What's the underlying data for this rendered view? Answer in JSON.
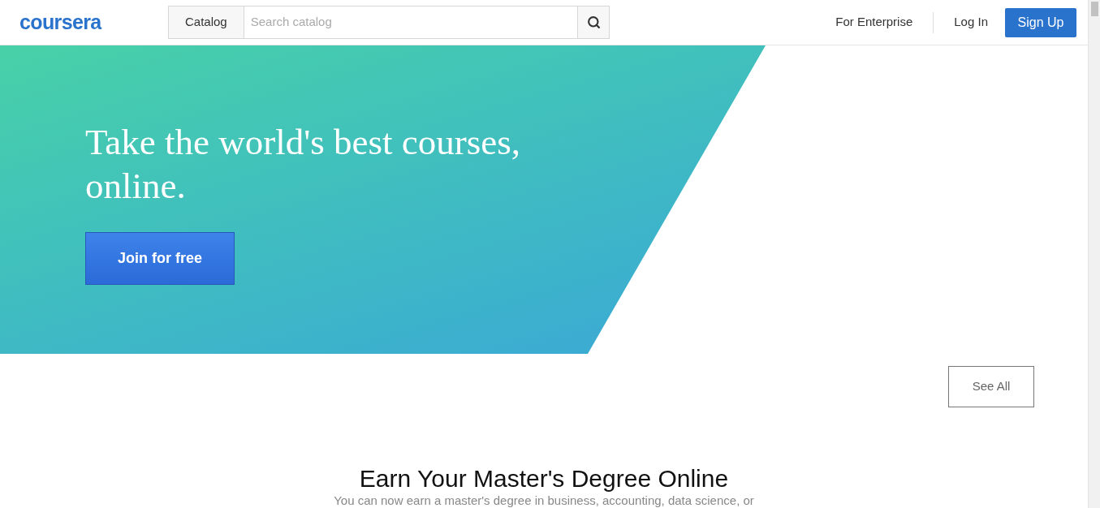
{
  "header": {
    "logo": "coursera",
    "catalog_button": "Catalog",
    "search": {
      "placeholder": "Search catalog"
    },
    "links": [
      "For Enterprise",
      "Log In"
    ],
    "signup_button": "Sign Up"
  },
  "hero": {
    "title": "Take the world's best courses, online.",
    "cta": "Join for free"
  },
  "see_all_button": "See All",
  "section": {
    "title": "Earn Your Master's Degree Online",
    "subtitle": "You can now earn a master's degree in business, accounting, data science, or"
  }
}
